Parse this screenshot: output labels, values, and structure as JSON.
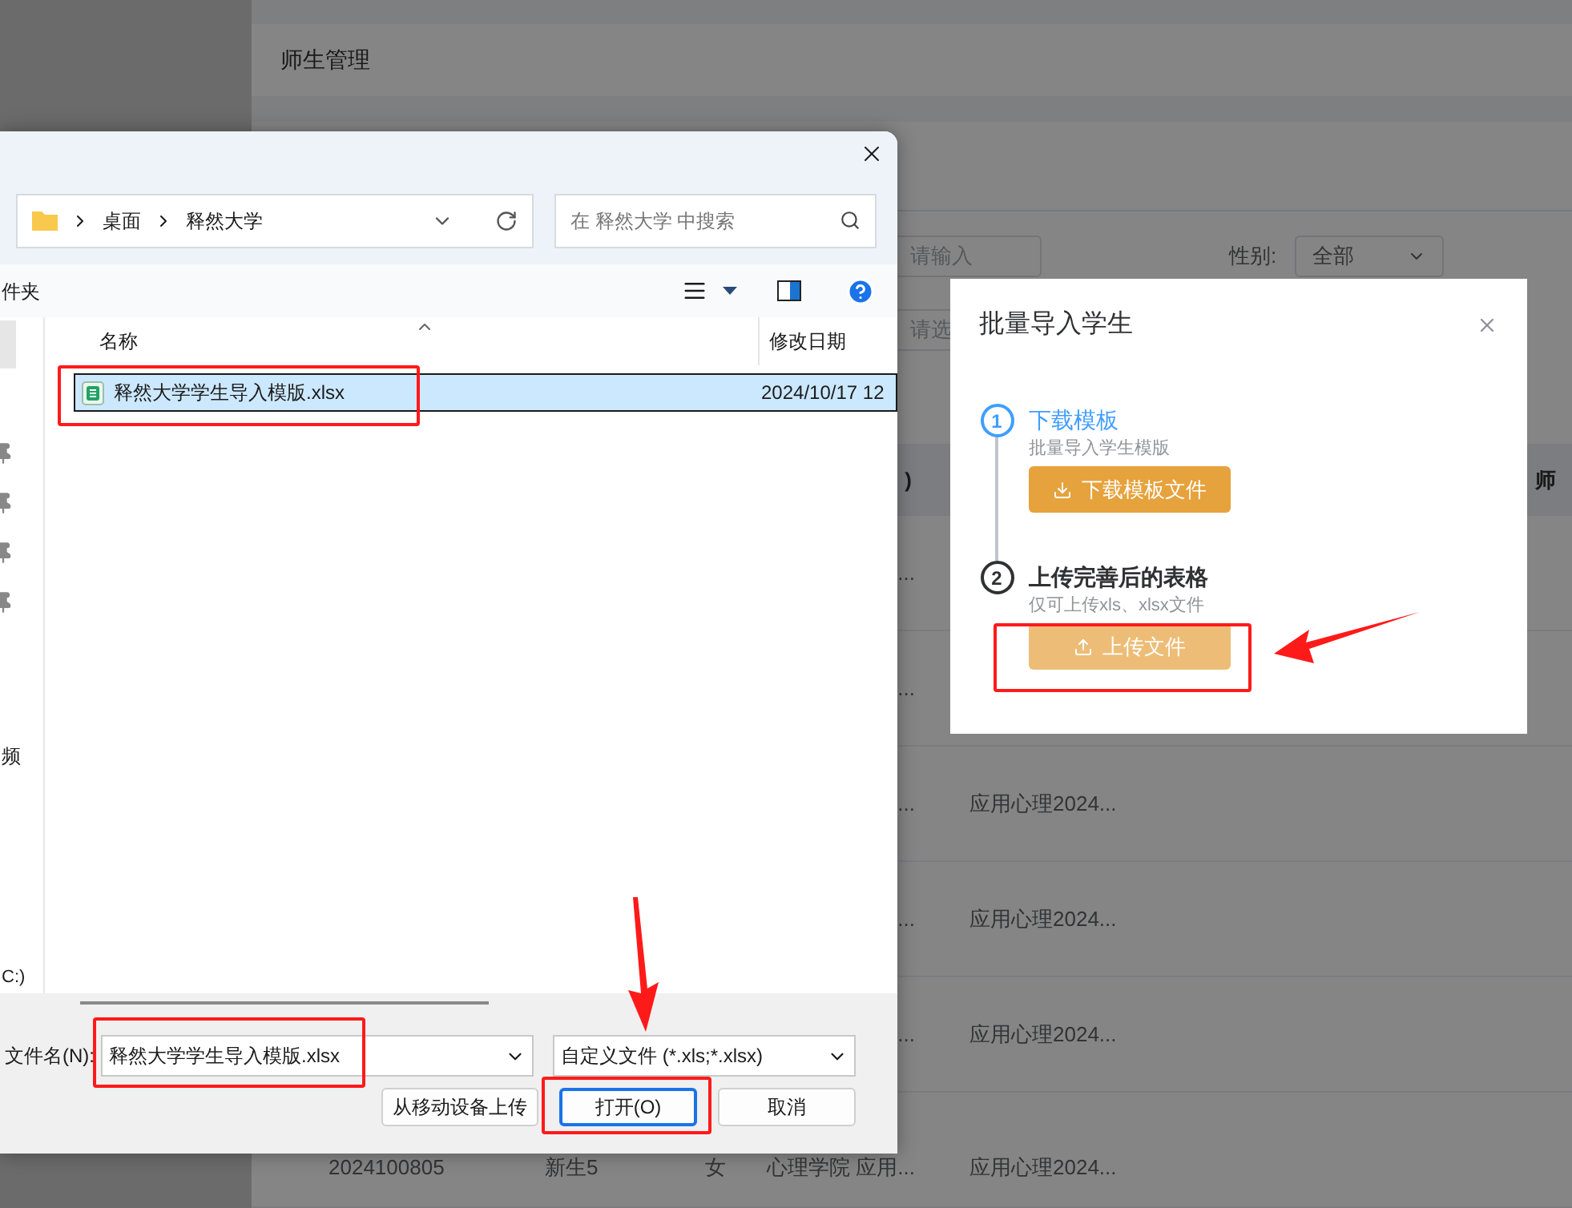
{
  "page": {
    "title": "师生管理",
    "filter_rows": [
      [
        {
          "kind": "input",
          "placeholder": "请输入"
        },
        {
          "kind": "select",
          "label": "性别:",
          "value": "全部"
        }
      ],
      [
        {
          "kind": "input",
          "placeholder": "请选"
        }
      ]
    ],
    "table": {
      "columns": {
        "college": ")",
        "teacher": "师"
      },
      "rows": [
        {
          "college": "..."
        },
        {
          "college": "..."
        },
        {
          "college": "...",
          "class": "应用心理2024..."
        },
        {
          "college": "...",
          "class": "应用心理2024..."
        },
        {
          "college": "...",
          "class": "应用心理2024..."
        },
        {
          "id": "2024100805",
          "name": "新生5",
          "gender": "女",
          "college": "心理学院 应用...",
          "class": "应用心理2024..."
        }
      ]
    }
  },
  "file_dialog": {
    "path": [
      "桌面",
      "释然大学"
    ],
    "search": {
      "placeholder": "在 释然大学 中搜索"
    },
    "toolbar_text": "件夹",
    "nav_items": [
      "频",
      "C:)"
    ],
    "columns": [
      "名称",
      "修改日期"
    ],
    "files": [
      {
        "name": "释然大学学生导入模版.xlsx",
        "modified": "2024/10/17 12",
        "selected": true
      }
    ],
    "filename_label": "文件名(N):",
    "filename": "释然大学学生导入模版.xlsx",
    "filetype": "自定义文件 (*.xls;*.xlsx)",
    "buttons": [
      {
        "label": "从移动设备上传",
        "default": false
      },
      {
        "label": "打开(O)",
        "default": true
      },
      {
        "label": "取消",
        "default": false
      }
    ]
  },
  "modal": {
    "title": "批量导入学生",
    "steps": [
      {
        "number": "1",
        "title": "下载模板",
        "active": true,
        "description": "批量导入学生模版",
        "button": {
          "label": "下载模板文件",
          "kind": "download",
          "hover": false
        }
      },
      {
        "number": "2",
        "title": "上传完善后的表格",
        "active": false,
        "description": "仅可上传xls、xlsx文件",
        "button": {
          "label": "上传文件",
          "kind": "upload",
          "hover": true
        }
      }
    ]
  }
}
